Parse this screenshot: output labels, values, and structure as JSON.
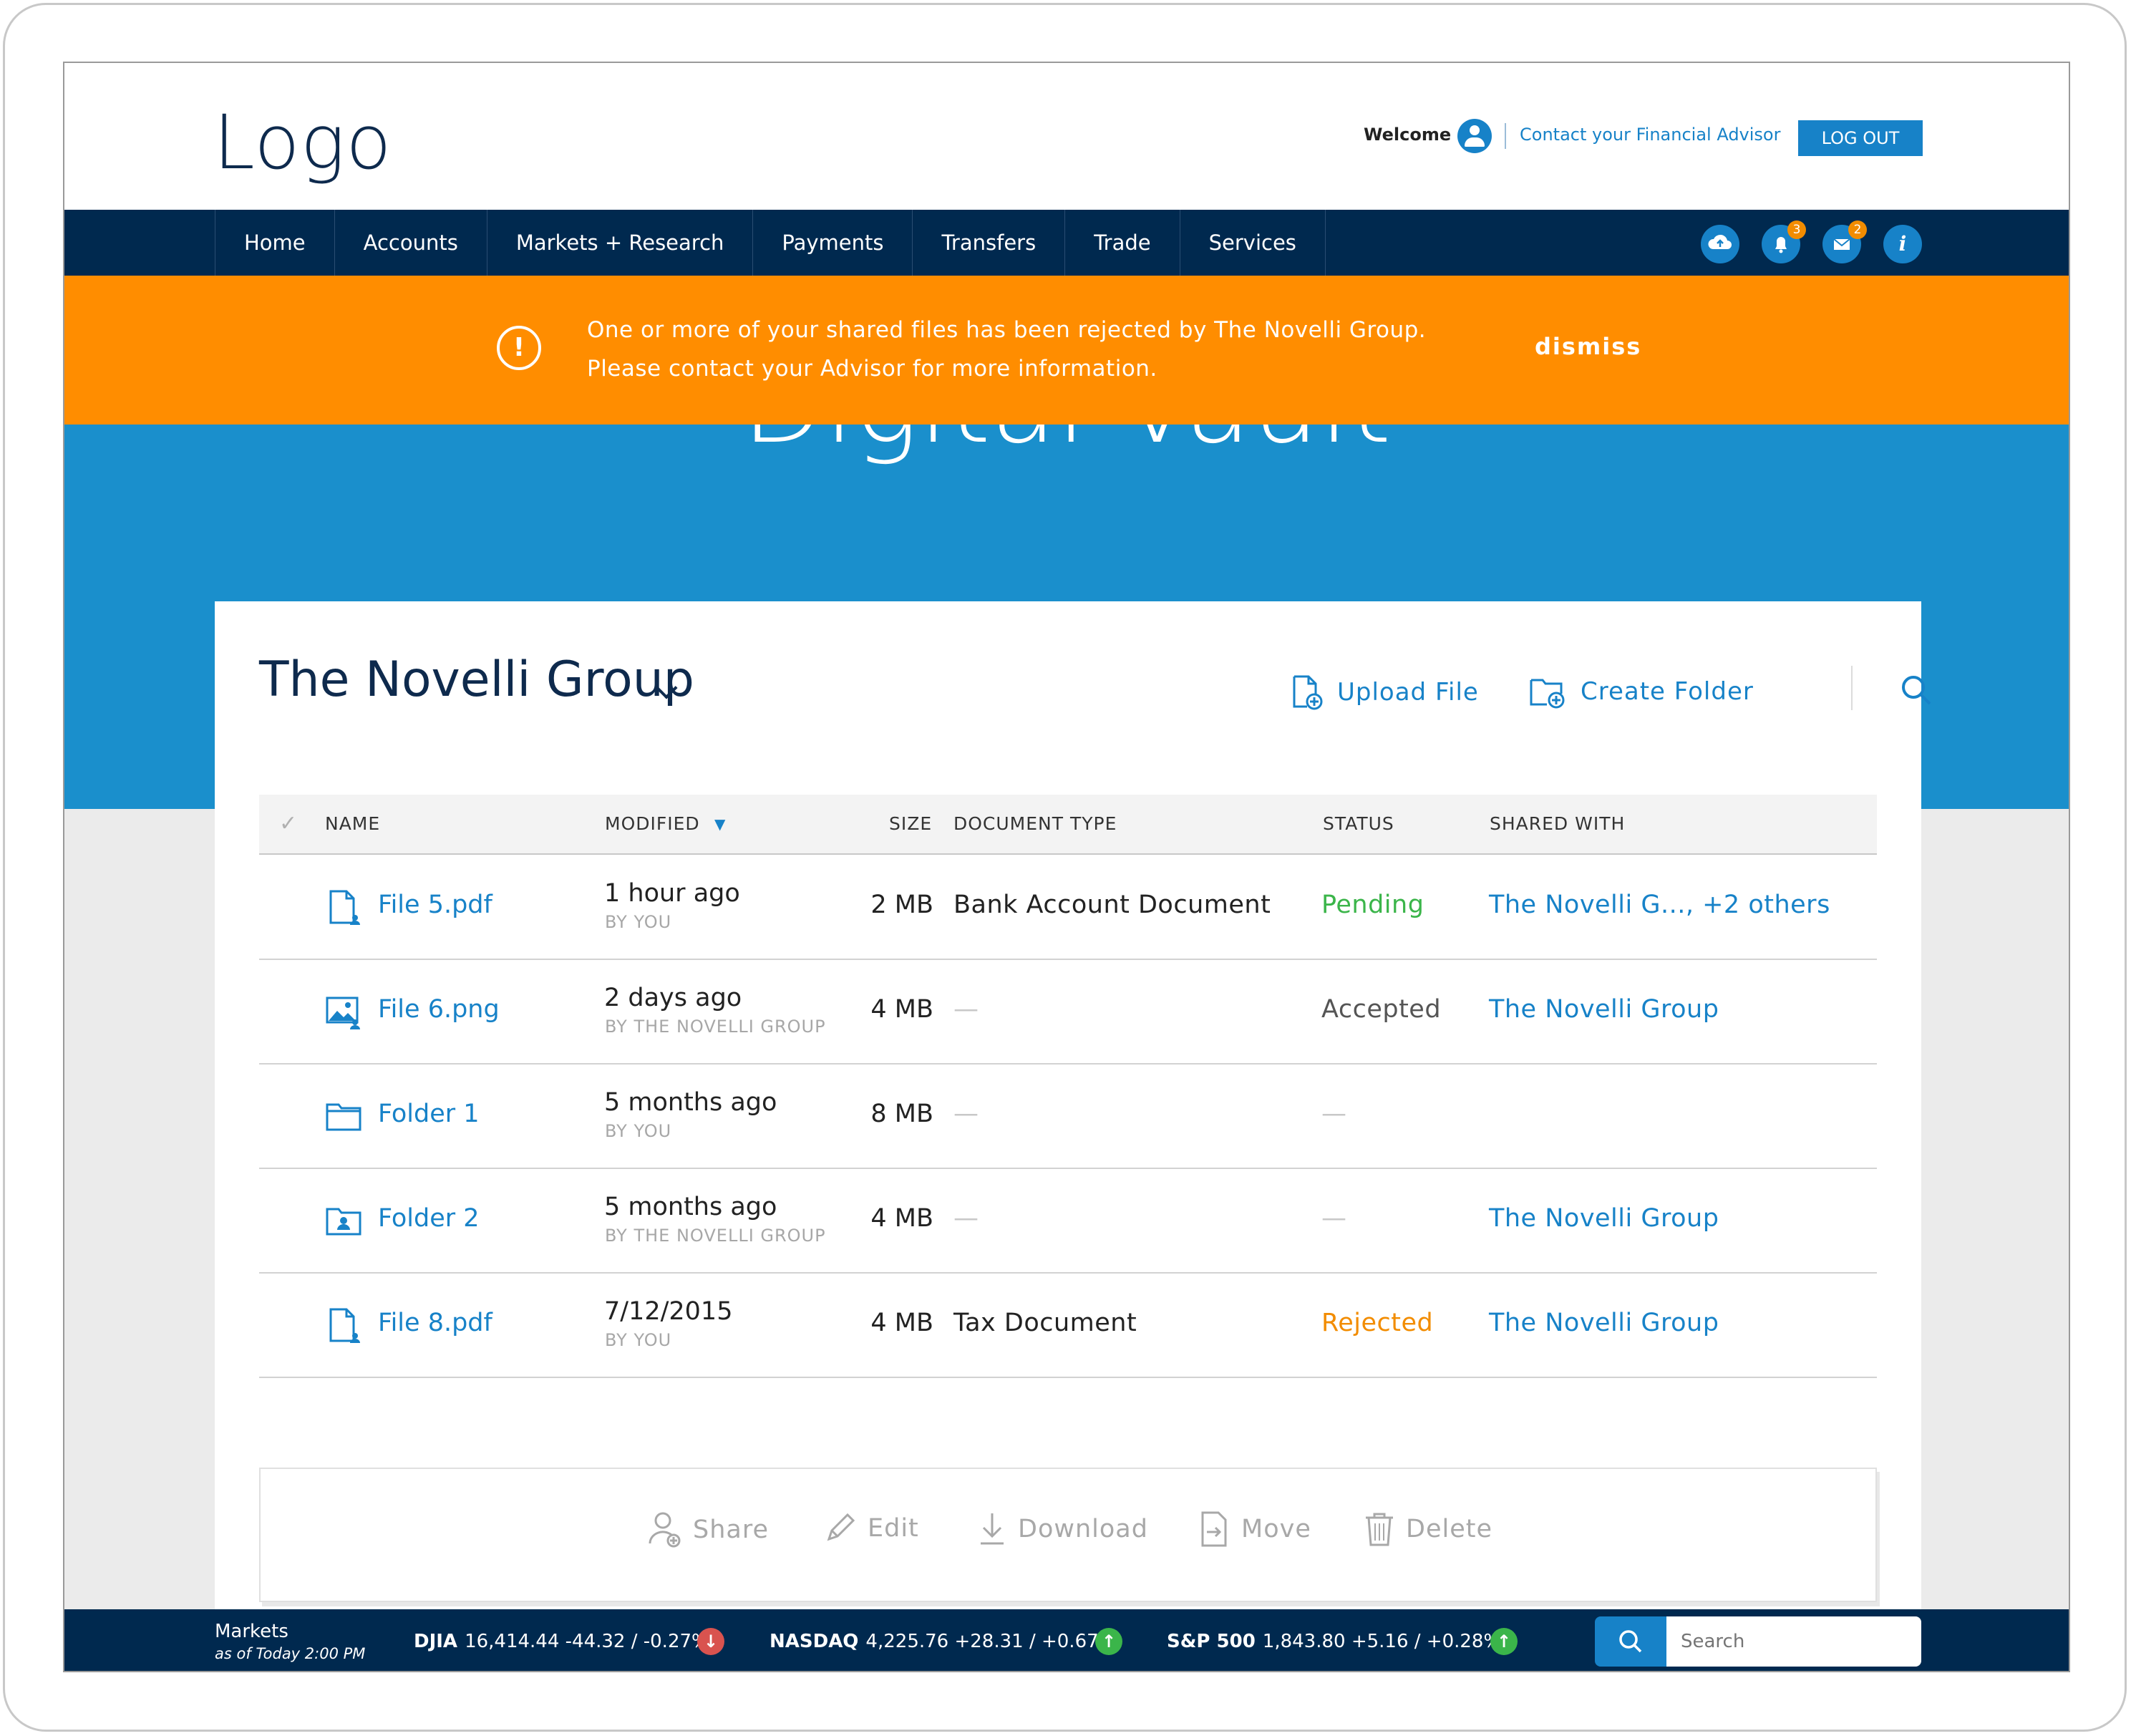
{
  "header": {
    "logo": "Logo",
    "welcome": "Welcome",
    "contact": "Contact your Financial Advisor",
    "logout": "LOG OUT"
  },
  "nav": {
    "items": [
      "Home",
      "Accounts",
      "Markets + Research",
      "Payments",
      "Transfers",
      "Trade",
      "Services"
    ],
    "icons": [
      {
        "name": "cloud-upload-icon",
        "badge": ""
      },
      {
        "name": "bell-icon",
        "badge": "3"
      },
      {
        "name": "mail-icon",
        "badge": "2"
      },
      {
        "name": "info-icon",
        "badge": ""
      }
    ]
  },
  "banner": {
    "line1": "One or more of your shared files has been rejected by The Novelli Group.",
    "line2": "Please contact your Advisor for more information.",
    "dismiss": "dismiss",
    "color": "#ff8d00"
  },
  "hero": {
    "title": "Digital Vault",
    "color": "#1a8fcc"
  },
  "vault": {
    "group": "The Novelli Group",
    "upload": "Upload File",
    "create_folder": "Create Folder"
  },
  "table": {
    "headers": {
      "name": "NAME",
      "modified": "MODIFIED",
      "size": "SIZE",
      "doc_type": "DOCUMENT TYPE",
      "status": "STATUS",
      "shared": "SHARED WITH"
    },
    "rows": [
      {
        "icon": "pdf-file-icon",
        "name": "File 5.pdf",
        "modified": "1 hour ago",
        "by": "BY YOU",
        "size": "2 MB",
        "doc_type": "Bank Account Document",
        "status": "Pending",
        "status_color": "#3bb54a",
        "shared": "The Novelli G..., +2 others"
      },
      {
        "icon": "image-file-icon",
        "name": "File 6.png",
        "modified": "2 days ago",
        "by": "BY THE NOVELLI GROUP",
        "size": "4 MB",
        "doc_type": "—",
        "status": "Accepted",
        "status_color": "#555555",
        "shared": "The Novelli Group"
      },
      {
        "icon": "folder-icon",
        "name": "Folder 1",
        "modified": "5 months ago",
        "by": "BY YOU",
        "size": "8 MB",
        "doc_type": "—",
        "status": "—",
        "status_color": "#c8c8c8",
        "shared": ""
      },
      {
        "icon": "shared-folder-icon",
        "name": "Folder 2",
        "modified": "5 months ago",
        "by": "BY THE NOVELLI GROUP",
        "size": "4 MB",
        "doc_type": "—",
        "status": "—",
        "status_color": "#c8c8c8",
        "shared": "The Novelli Group"
      },
      {
        "icon": "pdf-file-icon",
        "name": "File 8.pdf",
        "modified": "7/12/2015",
        "by": "BY YOU",
        "size": "4 MB",
        "doc_type": "Tax Document",
        "status": "Rejected",
        "status_color": "#f28c00",
        "shared": "The Novelli Group"
      }
    ]
  },
  "actions": {
    "share": "Share",
    "edit": "Edit",
    "download": "Download",
    "move": "Move",
    "delete": "Delete"
  },
  "ticker": {
    "markets": "Markets",
    "as_of": "as of Today 2:00 PM",
    "items": [
      {
        "name": "DJIA",
        "value": "16,414.44 -44.32 / -0.27%",
        "direction": "down",
        "color": "#d9534f"
      },
      {
        "name": "NASDAQ",
        "value": "4,225.76 +28.31 / +0.67%",
        "direction": "up",
        "color": "#3bb54a"
      },
      {
        "name": "S&P 500",
        "value": "1,843.80 +5.16 / +0.28%",
        "direction": "up",
        "color": "#3bb54a"
      }
    ],
    "search_placeholder": "Search"
  }
}
